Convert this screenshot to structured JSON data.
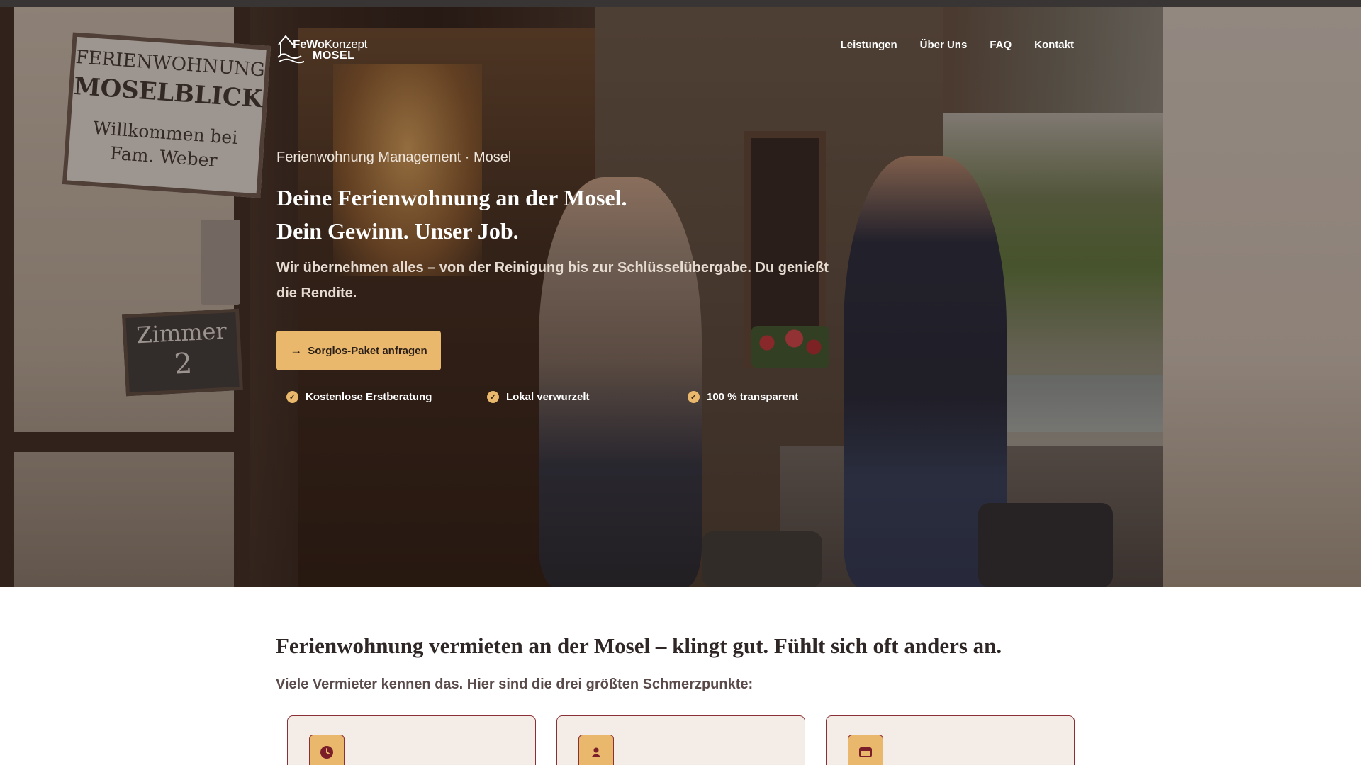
{
  "logo": {
    "brand_light": "FeWo",
    "brand_rest": "Konzept",
    "sub": "MOSEL"
  },
  "nav": {
    "items": [
      "Leistungen",
      "Über Uns",
      "FAQ",
      "Kontakt"
    ]
  },
  "hero": {
    "eyebrow": "Ferienwohnung Management · Mosel",
    "headline_line1": "Deine Ferienwohnung an der Mosel.",
    "headline_line2": "Dein Gewinn. Unser Job.",
    "subline": "Wir übernehmen alles – von der Reinigung bis zur Schlüsselübergabe. Du genießt die Rendite.",
    "cta_label": "Sorglos-Paket anfragen",
    "checks": [
      "Kostenlose Erstberatung",
      "Lokal verwurzelt",
      "100 % transparent"
    ],
    "sign_lines": [
      "FERIENWOHNUNG",
      "MOSELBLICK",
      "Willkommen bei",
      "Fam. Weber"
    ],
    "slate_lines": [
      "Zimmer",
      "2"
    ]
  },
  "section2": {
    "title": "Ferienwohnung vermieten an der Mosel – klingt gut. Fühlt sich oft anders an.",
    "subtitle": "Viele Vermieter kennen das. Hier sind die drei größten Schmerzpunkte:",
    "cards": [
      {
        "icon": "clock-icon"
      },
      {
        "icon": "person-icon"
      },
      {
        "icon": "calendar-card-icon"
      }
    ]
  },
  "colors": {
    "accent": "#e9b86c",
    "border": "#8a2f36",
    "card_bg": "#f4ece6"
  }
}
